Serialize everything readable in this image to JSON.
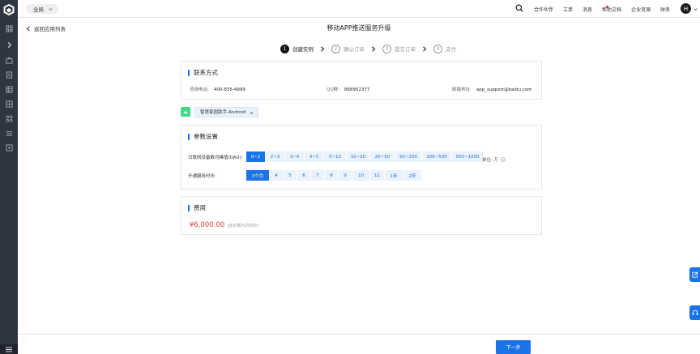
{
  "topbar": {
    "region": "全局",
    "nav": [
      "合作伙伴",
      "工单",
      "消息",
      "帮助文档",
      "企业资源",
      "财务"
    ],
    "avatar_letter": "H"
  },
  "header": {
    "back_label": "返回应用列表",
    "title": "移动APP推送服务升级"
  },
  "steps": [
    {
      "num": "1",
      "label": "创建实例"
    },
    {
      "num": "2",
      "label": "确认订单"
    },
    {
      "num": "3",
      "label": "提交订单"
    },
    {
      "num": "4",
      "label": "支付"
    }
  ],
  "contact": {
    "title": "联系方式",
    "phone_label": "咨询电话:",
    "phone": "400-835-4999",
    "qq_label": "QQ群:",
    "qq": "868952377",
    "email_label": "邮箱地址:",
    "email": "app_support@baidu.com"
  },
  "app": {
    "selected": "智慧家园助手-Android"
  },
  "params": {
    "title": "参数设置",
    "dau_label": "日联网设备数月峰值(DAU):",
    "dau_options": [
      "0~2",
      "2~3",
      "3~4",
      "4~5",
      "5~10",
      "10~20",
      "20~50",
      "50~200",
      "200~500",
      "500~1000"
    ],
    "dau_selected": 0,
    "unit_label": "单位: 万",
    "duration_label": "开通服务时长:",
    "duration_options": [
      "3个月",
      "4",
      "5",
      "6",
      "7",
      "8",
      "9",
      "10",
      "11",
      "1年",
      "2年"
    ],
    "duration_selected": 0
  },
  "cost": {
    "title": "费用",
    "amount": "¥6,000.00",
    "note": "(此价格为月均价)"
  },
  "footer": {
    "next_label": "下一步"
  },
  "colors": {
    "accent": "#1a73e8",
    "price": "#e53935",
    "sidebar": "#2f3541",
    "app_icon": "#3ddc84"
  }
}
